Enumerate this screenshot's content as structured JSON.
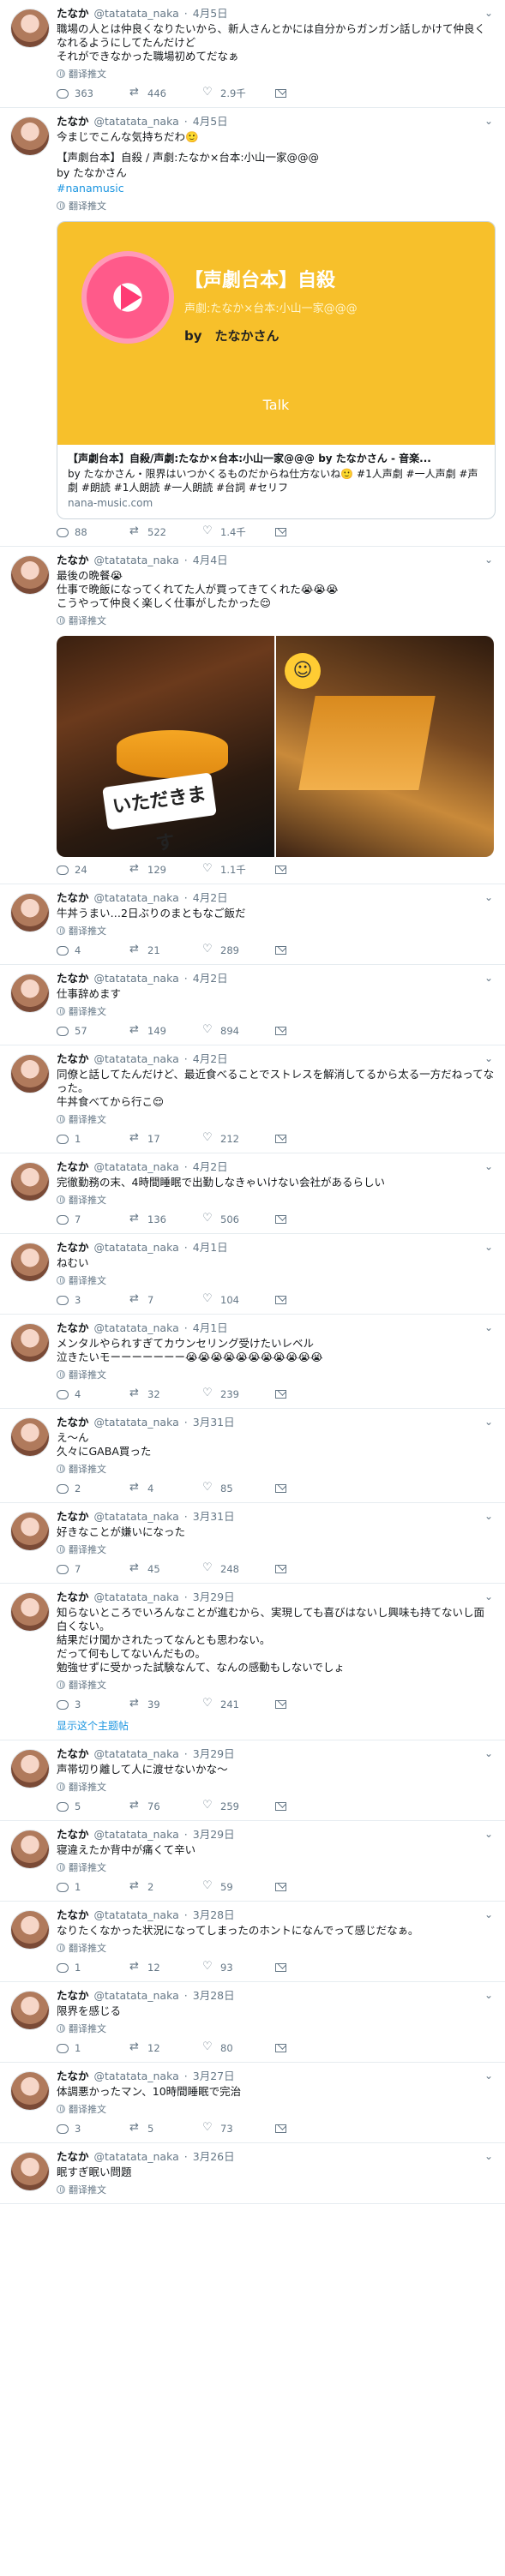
{
  "icons": {
    "reply": "reply-icon",
    "retweet": "retweet-icon",
    "like": "heart-icon",
    "dm": "envelope-icon",
    "translate": "globe-icon",
    "more": "chevron-down-icon"
  },
  "translate_label": "翻译推文",
  "thread_label": "显示这个主题帖",
  "tweets": [
    {
      "name": "たなか",
      "handle": "@tatatata_naka",
      "time": "4月5日",
      "text": "職場の人とは仲良くなりたいから、新人さんとかには自分からガンガン話しかけて仲良くなれるようにしてたんだけど\nそれができなかった職場初めてだなぁ",
      "reply": "363",
      "retweet": "446",
      "like": "2.9千"
    },
    {
      "name": "たなか",
      "handle": "@tatatata_naka",
      "time": "4月5日",
      "text": "今まじでこんな気持ちだわ🙂",
      "quote_line": "【声劇台本】自殺 / 声劇:たなか×台本:小山一家@@@",
      "quote_by": "by たなかさん",
      "hashtag": "#nanamusic",
      "card": {
        "title": "【声劇台本】自殺",
        "sub": "声劇:たなか×台本:小山一家@@@",
        "by": "by　たなかさん",
        "talk": "Talk",
        "head": "【声劇台本】自殺/声劇:たなか×台本:小山一家@@@ by たなかさん - 音楽...",
        "desc": "by たなかさん・限界はいつかくるものだからね仕方ないね🙂 #1人声劇 #一人声劇 #声劇 #朗読 #1人朗読 #一人朗読 #台詞 #セリフ",
        "domain": "nana-music.com"
      },
      "reply": "88",
      "retweet": "522",
      "like": "1.4千"
    },
    {
      "name": "たなか",
      "handle": "@tatatata_naka",
      "time": "4月4日",
      "text": "最後の晩餐😭\n仕事で晩飯になってくれてた人が買ってきてくれた😭😭😭\nこうやって仲良く楽しく仕事がしたかった😌",
      "photo_stamp": "いただきます",
      "reply": "24",
      "retweet": "129",
      "like": "1.1千"
    },
    {
      "name": "たなか",
      "handle": "@tatatata_naka",
      "time": "4月2日",
      "text": "牛丼うまい…2日ぶりのまともなご飯だ",
      "reply": "4",
      "retweet": "21",
      "like": "289"
    },
    {
      "name": "たなか",
      "handle": "@tatatata_naka",
      "time": "4月2日",
      "text": "仕事辞めます",
      "reply": "57",
      "retweet": "149",
      "like": "894"
    },
    {
      "name": "たなか",
      "handle": "@tatatata_naka",
      "time": "4月2日",
      "text": "同僚と話してたんだけど、最近食べることでストレスを解消してるから太る一方だねってなった。\n牛丼食べてから行こ😌",
      "reply": "1",
      "retweet": "17",
      "like": "212"
    },
    {
      "name": "たなか",
      "handle": "@tatatata_naka",
      "time": "4月2日",
      "text": "完徹勤務の末、4時間睡眠で出勤しなきゃいけない会社があるらしい",
      "reply": "7",
      "retweet": "136",
      "like": "506"
    },
    {
      "name": "たなか",
      "handle": "@tatatata_naka",
      "time": "4月1日",
      "text": "ねむい",
      "reply": "3",
      "retweet": "7",
      "like": "104"
    },
    {
      "name": "たなか",
      "handle": "@tatatata_naka",
      "time": "4月1日",
      "text": "メンタルやられすぎてカウンセリング受けたいレベル\n泣きたいモーーーーーーー😭😭😭😭😭😭😭😭😭😭😭",
      "reply": "4",
      "retweet": "32",
      "like": "239"
    },
    {
      "name": "たなか",
      "handle": "@tatatata_naka",
      "time": "3月31日",
      "text": "え〜ん\n久々にGABA買った",
      "reply": "2",
      "retweet": "4",
      "like": "85"
    },
    {
      "name": "たなか",
      "handle": "@tatatata_naka",
      "time": "3月31日",
      "text": "好きなことが嫌いになった",
      "reply": "7",
      "retweet": "45",
      "like": "248"
    },
    {
      "name": "たなか",
      "handle": "@tatatata_naka",
      "time": "3月29日",
      "text": "知らないところでいろんなことが進むから、実現しても喜びはないし興味も持てないし面白くない。\n結果だけ聞かされたってなんとも思わない。\nだって何もしてないんだもの。\n勉強せずに受かった試験なんて、なんの感動もしないでしょ",
      "thread": true,
      "reply": "3",
      "retweet": "39",
      "like": "241"
    },
    {
      "name": "たなか",
      "handle": "@tatatata_naka",
      "time": "3月29日",
      "text": "声帯切り離して人に渡せないかな〜",
      "reply": "5",
      "retweet": "76",
      "like": "259"
    },
    {
      "name": "たなか",
      "handle": "@tatatata_naka",
      "time": "3月29日",
      "text": "寝違えたか背中が痛くて辛い",
      "reply": "1",
      "retweet": "2",
      "like": "59"
    },
    {
      "name": "たなか",
      "handle": "@tatatata_naka",
      "time": "3月28日",
      "text": "なりたくなかった状況になってしまったのホントになんでって感じだなぁ。",
      "reply": "1",
      "retweet": "12",
      "like": "93"
    },
    {
      "name": "たなか",
      "handle": "@tatatata_naka",
      "time": "3月28日",
      "text": "限界を感じる",
      "reply": "1",
      "retweet": "12",
      "like": "80"
    },
    {
      "name": "たなか",
      "handle": "@tatatata_naka",
      "time": "3月27日",
      "text": "体調悪かったマン、10時間睡眠で完治",
      "reply": "3",
      "retweet": "5",
      "like": "73"
    },
    {
      "name": "たなか",
      "handle": "@tatatata_naka",
      "time": "3月26日",
      "text": "眠すぎ眠い問題",
      "reply": "",
      "retweet": "",
      "like": ""
    }
  ]
}
